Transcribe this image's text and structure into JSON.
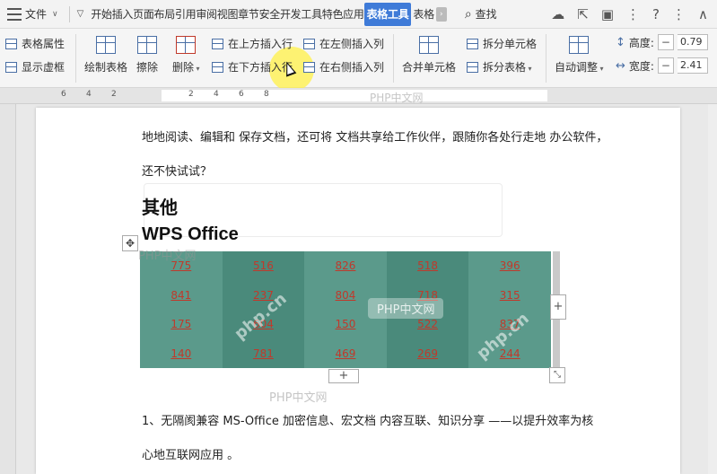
{
  "menu": {
    "file_label": "文件"
  },
  "tabs": [
    {
      "label": "开始"
    },
    {
      "label": "插入"
    },
    {
      "label": "页面布局"
    },
    {
      "label": "引用"
    },
    {
      "label": "审阅"
    },
    {
      "label": "视图"
    },
    {
      "label": "章节"
    },
    {
      "label": "安全"
    },
    {
      "label": "开发工具"
    },
    {
      "label": "特色应用"
    },
    {
      "label": "表格工具"
    },
    {
      "label": "表格"
    }
  ],
  "search": {
    "label": "查找"
  },
  "ribbon": {
    "table_props": "表格属性",
    "show_gridlines": "显示虚框",
    "draw_table": "绘制表格",
    "erase": "擦除",
    "delete": "删除",
    "insert_above": "在上方插入行",
    "insert_below": "在下方插入行",
    "insert_left": "在左侧插入列",
    "insert_right": "在右侧插入列",
    "merge_cells": "合并单元格",
    "split_cells": "拆分单元格",
    "split_table": "拆分表格",
    "auto_fit": "自动调整",
    "height_label": "高度:",
    "height_value": "0.79",
    "width_label": "宽度:",
    "width_value": "2.41"
  },
  "ruler": {
    "numbers": [
      "6",
      "4",
      "2",
      "2",
      "4",
      "6",
      "8"
    ]
  },
  "document": {
    "line1": "地地阅读、编辑和 保存文档，还可将 文档共享给工作伙伴，跟随你各处行走地 办公软件，",
    "line2": "还不快试试？",
    "heading_other": "其他",
    "heading_wps": "WPS Office",
    "list_line1": "1、无隔阂兼容 MS-Office 加密信息、宏文档 内容互联、知识分享 ——以提升效率为核",
    "list_line2": "心地互联网应用 。"
  },
  "table": {
    "rows": [
      [
        "775",
        "516",
        "826",
        "518",
        "396"
      ],
      [
        "841",
        "237",
        "804",
        "718",
        "315"
      ],
      [
        "175",
        "604",
        "150",
        "522",
        "837"
      ],
      [
        "140",
        "781",
        "469",
        "269",
        "244"
      ]
    ]
  },
  "watermark": {
    "text": "PHP中文网",
    "brand": "php.cn"
  },
  "colors": {
    "accent": "#3f7bd8",
    "table_fill": "#5b9a8b",
    "table_text": "#c0392b"
  }
}
